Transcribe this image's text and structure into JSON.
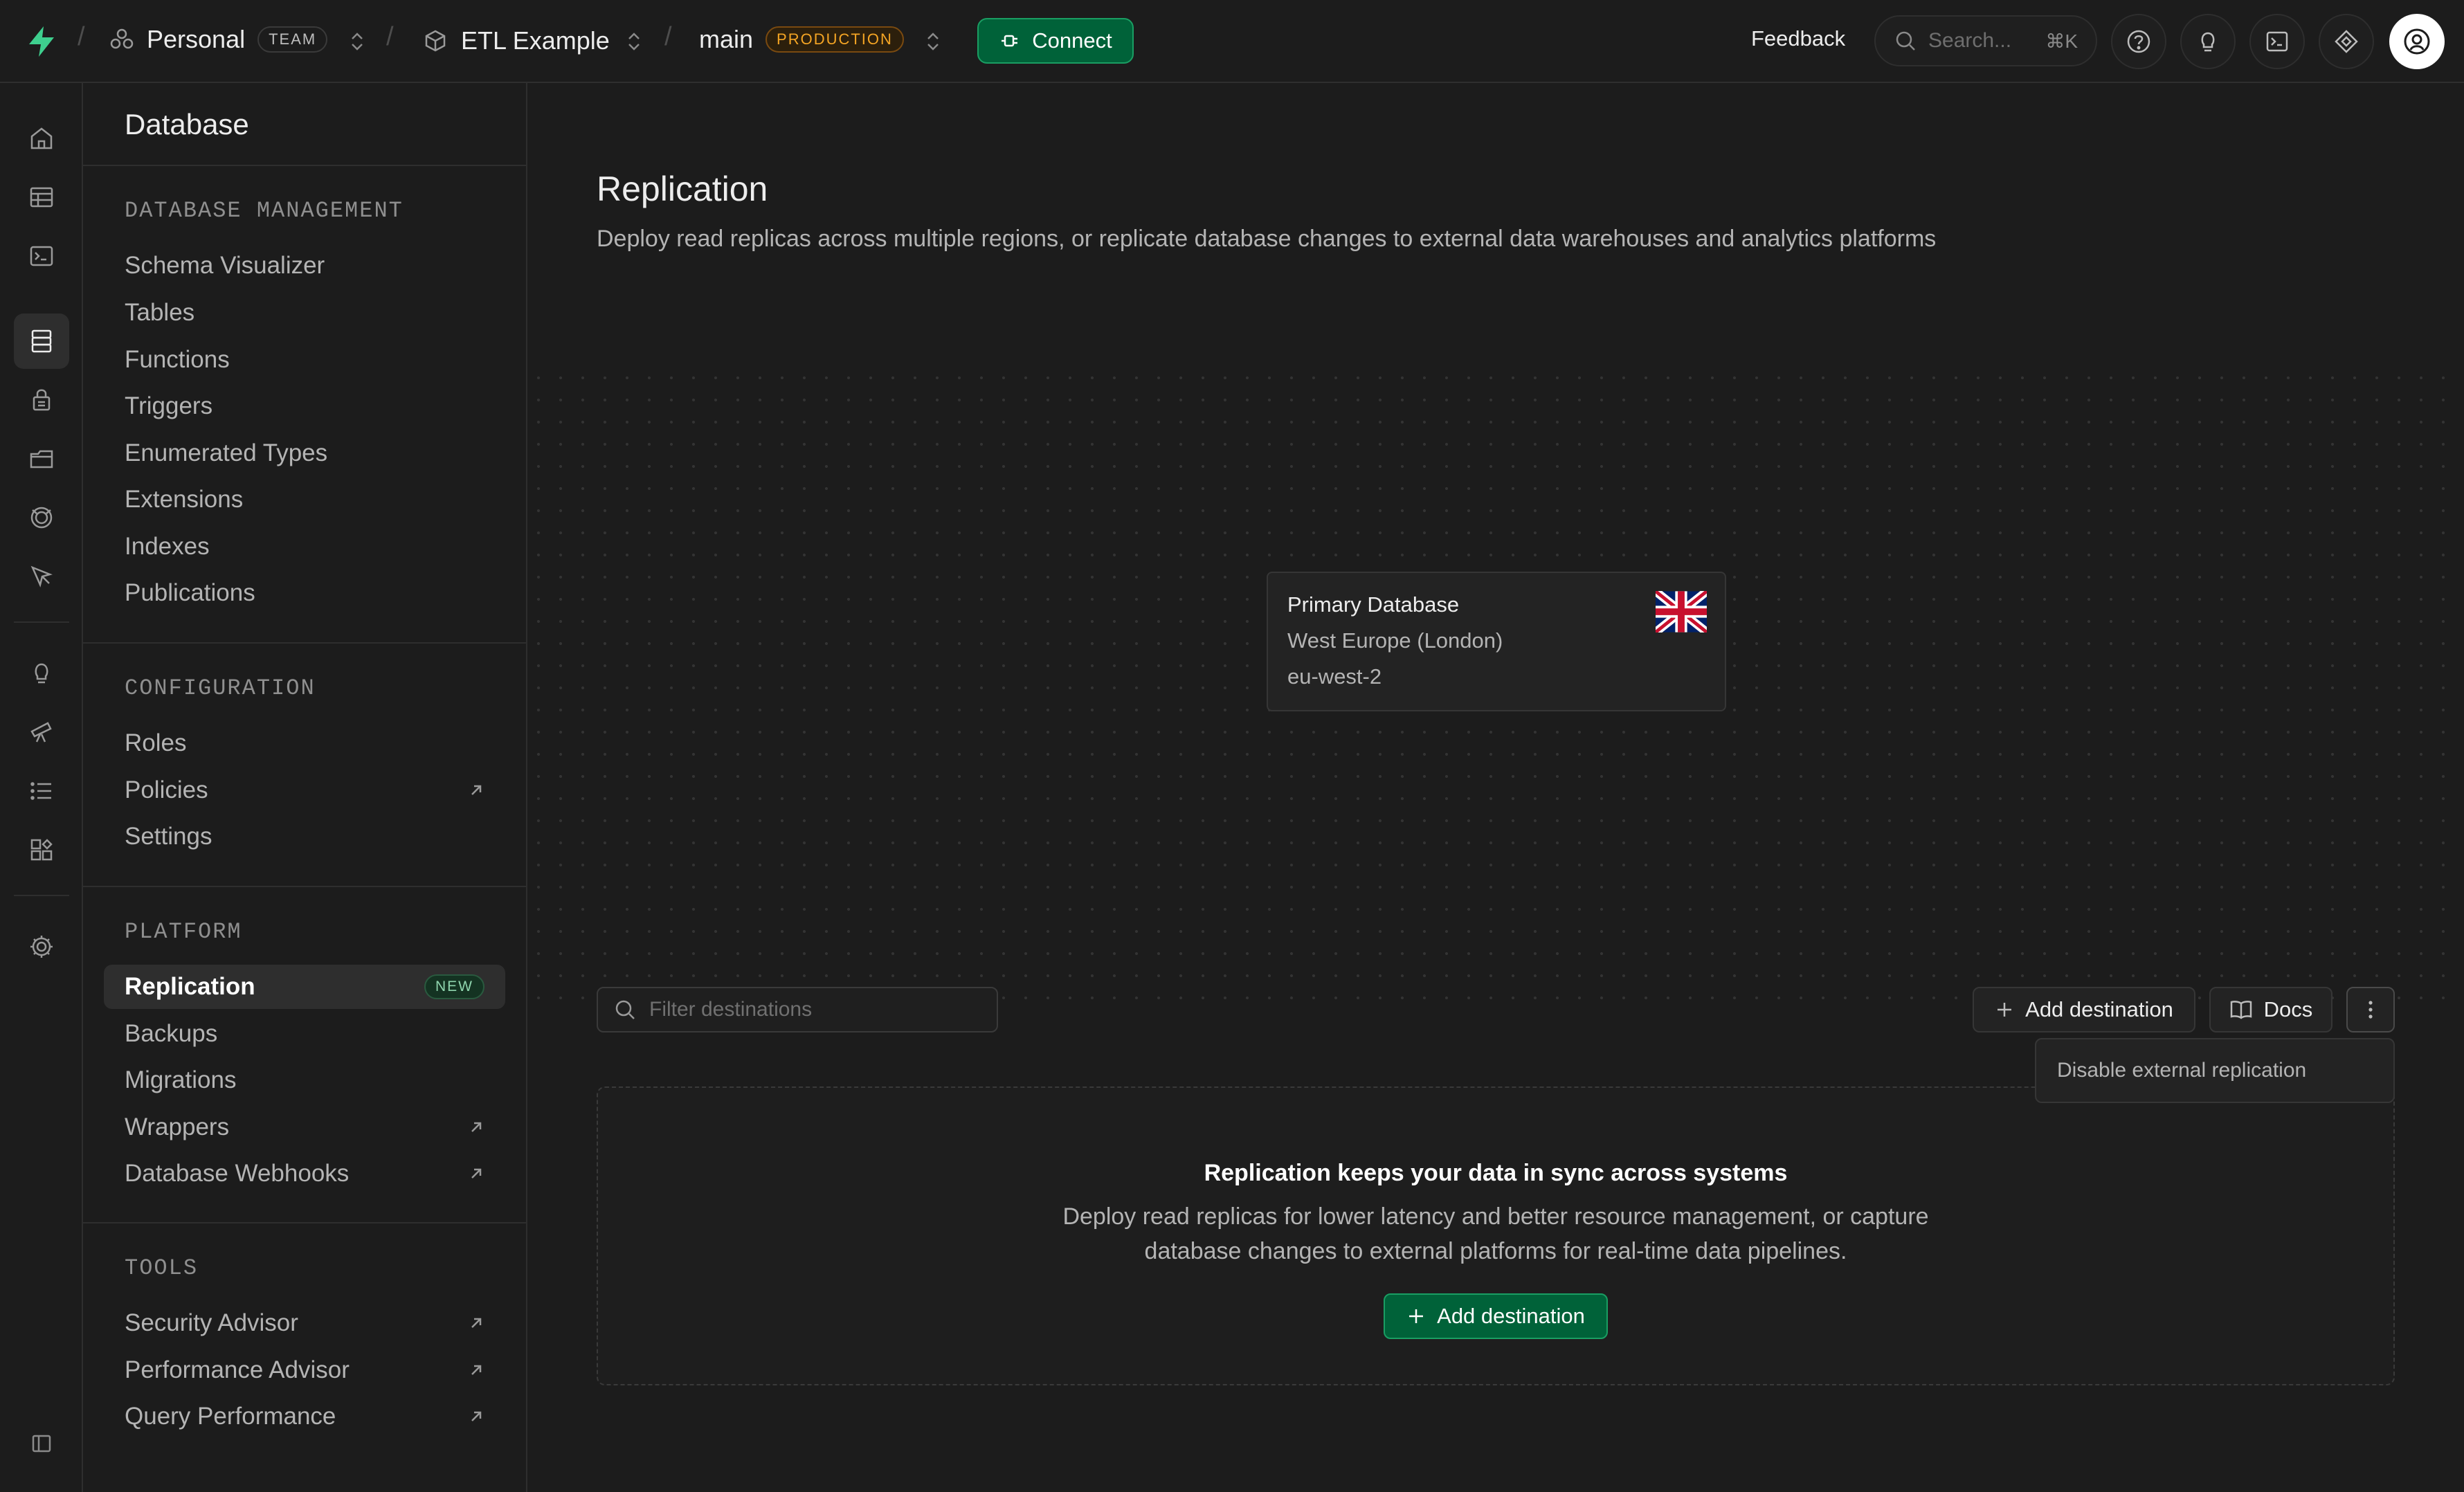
{
  "topbar": {
    "org": "Personal",
    "org_badge": "TEAM",
    "project": "ETL Example",
    "branch": "main",
    "branch_badge": "PRODUCTION",
    "connect_label": "Connect",
    "feedback_label": "Feedback",
    "search_placeholder": "Search...",
    "search_shortcut": "⌘K"
  },
  "sidebar": {
    "title": "Database",
    "sections": [
      {
        "heading": "DATABASE MANAGEMENT",
        "items": [
          {
            "label": "Schema Visualizer"
          },
          {
            "label": "Tables"
          },
          {
            "label": "Functions"
          },
          {
            "label": "Triggers"
          },
          {
            "label": "Enumerated Types"
          },
          {
            "label": "Extensions"
          },
          {
            "label": "Indexes"
          },
          {
            "label": "Publications"
          }
        ]
      },
      {
        "heading": "CONFIGURATION",
        "items": [
          {
            "label": "Roles"
          },
          {
            "label": "Policies",
            "external": true
          },
          {
            "label": "Settings"
          }
        ]
      },
      {
        "heading": "PLATFORM",
        "items": [
          {
            "label": "Replication",
            "badge": "NEW",
            "active": true
          },
          {
            "label": "Backups"
          },
          {
            "label": "Migrations"
          },
          {
            "label": "Wrappers",
            "external": true
          },
          {
            "label": "Database Webhooks",
            "external": true
          }
        ]
      },
      {
        "heading": "TOOLS",
        "items": [
          {
            "label": "Security Advisor",
            "external": true
          },
          {
            "label": "Performance Advisor",
            "external": true
          },
          {
            "label": "Query Performance",
            "external": true
          }
        ]
      }
    ]
  },
  "main": {
    "title": "Replication",
    "description": "Deploy read replicas across multiple regions, or replicate database changes to external data warehouses and analytics platforms",
    "primary_db": {
      "name": "Primary Database",
      "region": "West Europe (London)",
      "code": "eu-west-2",
      "flag": "uk-flag"
    },
    "filter_placeholder": "Filter destinations",
    "add_destination_label": "Add destination",
    "docs_label": "Docs",
    "menu_item": "Disable external replication",
    "empty_title": "Replication keeps your data in sync across systems",
    "empty_description": "Deploy read replicas for lower latency and better resource management, or capture database changes to external platforms for real-time data pipelines.",
    "empty_button_label": "Add destination"
  },
  "colors": {
    "brand_green": "#006239",
    "brand_green_border": "#1a9e63",
    "production_orange": "#f5a524",
    "background": "#1c1c1c"
  }
}
